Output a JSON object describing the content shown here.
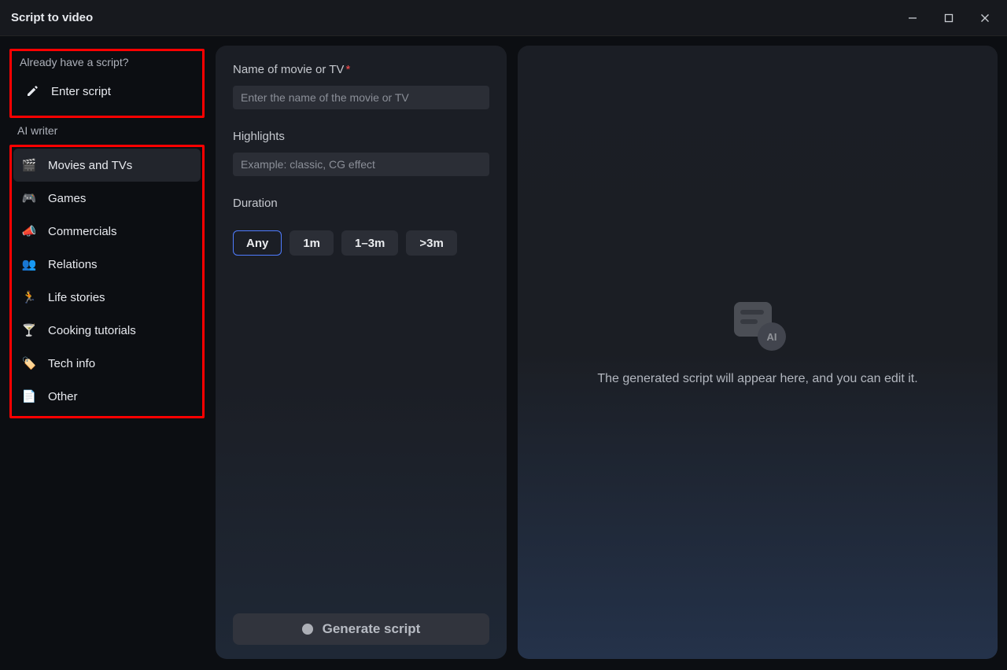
{
  "window": {
    "title": "Script to video"
  },
  "sidebar": {
    "have_script_label": "Already have a script?",
    "enter_script": "Enter script",
    "ai_writer_label": "AI writer",
    "items": [
      {
        "label": "Movies and TVs",
        "icon": "🎬"
      },
      {
        "label": "Games",
        "icon": "🎮"
      },
      {
        "label": "Commercials",
        "icon": "📣"
      },
      {
        "label": "Relations",
        "icon": "👥"
      },
      {
        "label": "Life stories",
        "icon": "🏃"
      },
      {
        "label": "Cooking tutorials",
        "icon": "🍸"
      },
      {
        "label": "Tech info",
        "icon": "🏷️"
      },
      {
        "label": "Other",
        "icon": "📄"
      }
    ]
  },
  "form": {
    "name_label": "Name of movie or TV",
    "name_placeholder": "Enter the name of the movie or TV",
    "highlights_label": "Highlights",
    "highlights_placeholder": "Example: classic, CG effect",
    "duration_label": "Duration",
    "duration_options": [
      "Any",
      "1m",
      "1–3m",
      ">3m"
    ],
    "duration_selected": 0,
    "generate_label": "Generate script"
  },
  "preview": {
    "empty_text": "The generated script will appear here, and you can edit it.",
    "ai_badge": "AI"
  }
}
